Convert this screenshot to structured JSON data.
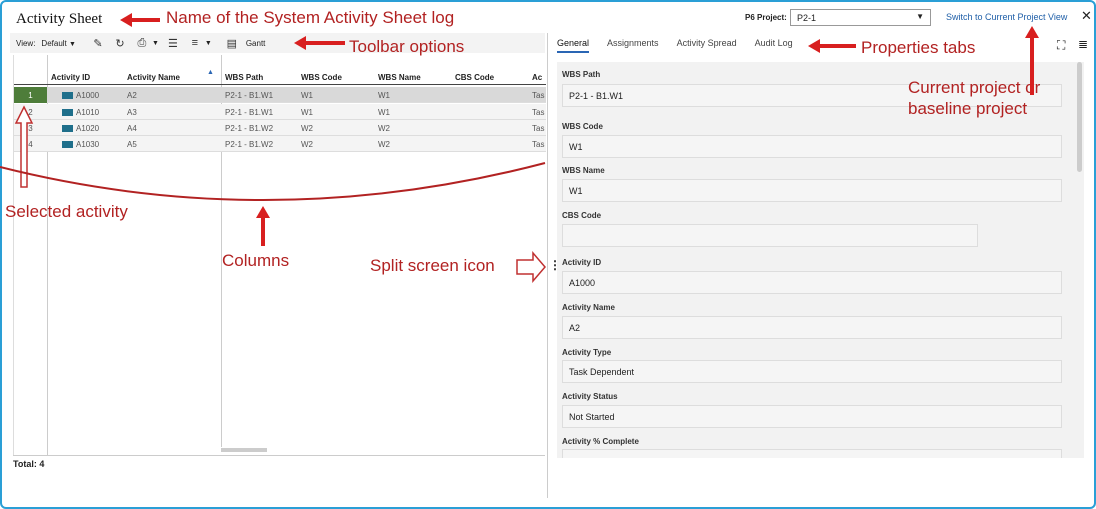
{
  "app": {
    "title": "Activity Sheet",
    "project_label": "P6 Project:",
    "project_value": "P2-1",
    "switch_link": "Switch to Current Project View"
  },
  "toolbar": {
    "view_label": "View:",
    "view_value": "Default",
    "gantt_label": "Gantt"
  },
  "grid": {
    "columns": [
      "Activity ID",
      "Activity Name",
      "WBS Path",
      "WBS Code",
      "WBS Name",
      "CBS Code",
      "Ac"
    ],
    "rows": [
      {
        "num": "1",
        "id": "A1000",
        "name": "A2",
        "wbs_path": "P2-1 - B1.W1",
        "wbs_code": "W1",
        "wbs_name": "W1",
        "cbs": "",
        "ac": "Tas"
      },
      {
        "num": "2",
        "id": "A1010",
        "name": "A3",
        "wbs_path": "P2-1 - B1.W1",
        "wbs_code": "W1",
        "wbs_name": "W1",
        "cbs": "",
        "ac": "Tas"
      },
      {
        "num": "3",
        "id": "A1020",
        "name": "A4",
        "wbs_path": "P2-1 - B1.W2",
        "wbs_code": "W2",
        "wbs_name": "W2",
        "cbs": "",
        "ac": "Tas"
      },
      {
        "num": "4",
        "id": "A1030",
        "name": "A5",
        "wbs_path": "P2-1 - B1.W2",
        "wbs_code": "W2",
        "wbs_name": "W2",
        "cbs": "",
        "ac": "Tas"
      }
    ],
    "total": "Total: 4"
  },
  "tabs": [
    "General",
    "Assignments",
    "Activity Spread",
    "Audit Log"
  ],
  "properties": [
    {
      "label": "WBS Path",
      "value": "P2-1 - B1.W1"
    },
    {
      "label": "WBS Code",
      "value": "W1"
    },
    {
      "label": "WBS Name",
      "value": "W1"
    },
    {
      "label": "CBS Code",
      "value": ""
    },
    {
      "label": "Activity ID",
      "value": "A1000"
    },
    {
      "label": "Activity Name",
      "value": "A2"
    },
    {
      "label": "Activity Type",
      "value": "Task Dependent"
    },
    {
      "label": "Activity Status",
      "value": "Not Started"
    },
    {
      "label": "Activity % Complete",
      "value": ""
    }
  ],
  "annotations": {
    "name_log": "Name of the System Activity Sheet log",
    "toolbar_options": "Toolbar options",
    "properties_tabs": "Properties tabs",
    "current_project_1": "Current project or",
    "current_project_2": "baseline project",
    "selected_activity": "Selected activity",
    "columns": "Columns",
    "split_screen": "Split screen icon"
  },
  "colors": {
    "annotation": "#b22222",
    "arrow": "#d81f1f",
    "selected_row": "#4e7d3a",
    "frame": "#2a9fd6"
  }
}
